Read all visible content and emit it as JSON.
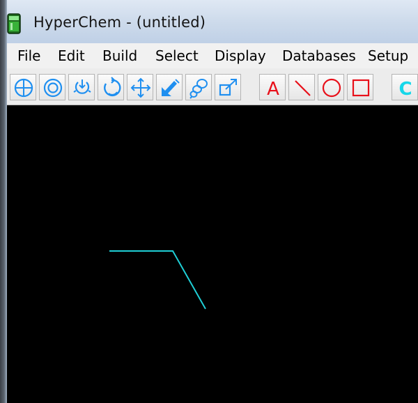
{
  "window": {
    "title": "HyperChem - (untitled)"
  },
  "menu": {
    "items": [
      "File",
      "Edit",
      "Build",
      "Select",
      "Display",
      "Databases",
      "Setup"
    ]
  },
  "toolbar": {
    "tools": [
      {
        "name": "draw-tool",
        "icon": "crosshair-circle-icon"
      },
      {
        "name": "select-tool",
        "icon": "double-circle-icon"
      },
      {
        "name": "rotate-xy-tool",
        "icon": "rotate-xy-icon"
      },
      {
        "name": "rotate-z-tool",
        "icon": "rotate-z-icon"
      },
      {
        "name": "translate-xy-tool",
        "icon": "four-arrows-icon"
      },
      {
        "name": "translate-z-tool",
        "icon": "diagonal-arrow-icon"
      },
      {
        "name": "zoom-tool",
        "icon": "magnifier-zoom-icon"
      },
      {
        "name": "clip-tool",
        "icon": "clip-box-icon"
      },
      {
        "name": "text-annotation-tool",
        "icon": "letter-a-icon",
        "label": "A"
      },
      {
        "name": "line-annotation-tool",
        "icon": "line-icon"
      },
      {
        "name": "ellipse-annotation-tool",
        "icon": "circle-icon"
      },
      {
        "name": "rectangle-annotation-tool",
        "icon": "square-icon"
      },
      {
        "name": "element-carbon-tool",
        "icon": "letter-c-icon",
        "label": "C"
      }
    ]
  },
  "colors": {
    "tool_blue": "#1f8ff0",
    "annotation_red": "#e8101a",
    "element_cyan": "#16d7e9",
    "bond_cyan": "#1fcfd6",
    "canvas_background": "#000000"
  },
  "canvas": {
    "molecule": "two connected bonds (three carbon atoms) drawn in cyan"
  }
}
